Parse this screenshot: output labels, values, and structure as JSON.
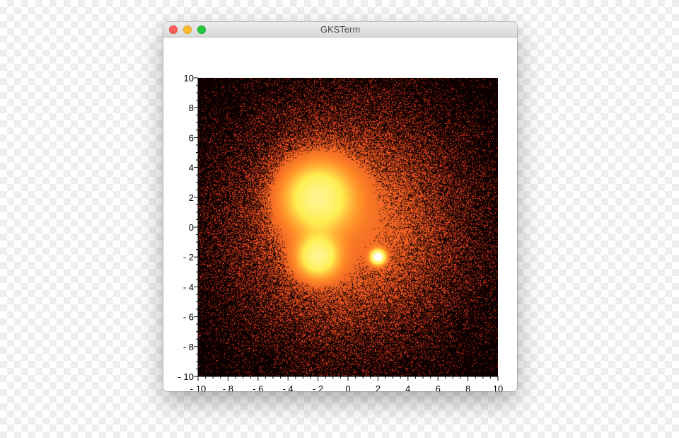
{
  "window": {
    "title": "GKSTerm"
  },
  "chart_data": {
    "type": "heatmap",
    "title": "",
    "xlabel": "",
    "ylabel": "",
    "xlim": [
      -10,
      10
    ],
    "ylim": [
      -10,
      10
    ],
    "grid": false,
    "colormap": "hot",
    "colors": {
      "background": "#0d0000",
      "low": "#e0301e",
      "mid": "#ff8c28",
      "high": "#ffee50",
      "peak": "#ffffff"
    },
    "xticks": [
      {
        "value": -10,
        "label": "- 10"
      },
      {
        "value": -8,
        "label": "- 8"
      },
      {
        "value": -6,
        "label": "- 6"
      },
      {
        "value": -4,
        "label": "- 4"
      },
      {
        "value": -2,
        "label": "- 2"
      },
      {
        "value": 0,
        "label": "0"
      },
      {
        "value": 2,
        "label": "2"
      },
      {
        "value": 4,
        "label": "4"
      },
      {
        "value": 6,
        "label": "6"
      },
      {
        "value": 8,
        "label": "8"
      },
      {
        "value": 10,
        "label": "10"
      }
    ],
    "yticks": [
      {
        "value": 10,
        "label": "10"
      },
      {
        "value": 8,
        "label": "8"
      },
      {
        "value": 6,
        "label": "6"
      },
      {
        "value": 4,
        "label": "4"
      },
      {
        "value": 2,
        "label": "2"
      },
      {
        "value": 0,
        "label": "0"
      },
      {
        "value": -2,
        "label": "- 2"
      },
      {
        "value": -4,
        "label": "- 4"
      },
      {
        "value": -6,
        "label": "- 6"
      },
      {
        "value": -8,
        "label": "- 8"
      },
      {
        "value": -10,
        "label": "- 10"
      }
    ],
    "minor_tick_step": 0.5,
    "clusters": [
      {
        "x": -2,
        "y": 2,
        "spread": 1.5,
        "peak": "bright"
      },
      {
        "x": -2,
        "y": -2,
        "spread": 0.9,
        "peak": "bright"
      },
      {
        "x": 2,
        "y": -2,
        "spread": 0.3,
        "peak": "white"
      },
      {
        "x": 0,
        "y": 0,
        "spread": 5,
        "peak": "background"
      }
    ]
  }
}
